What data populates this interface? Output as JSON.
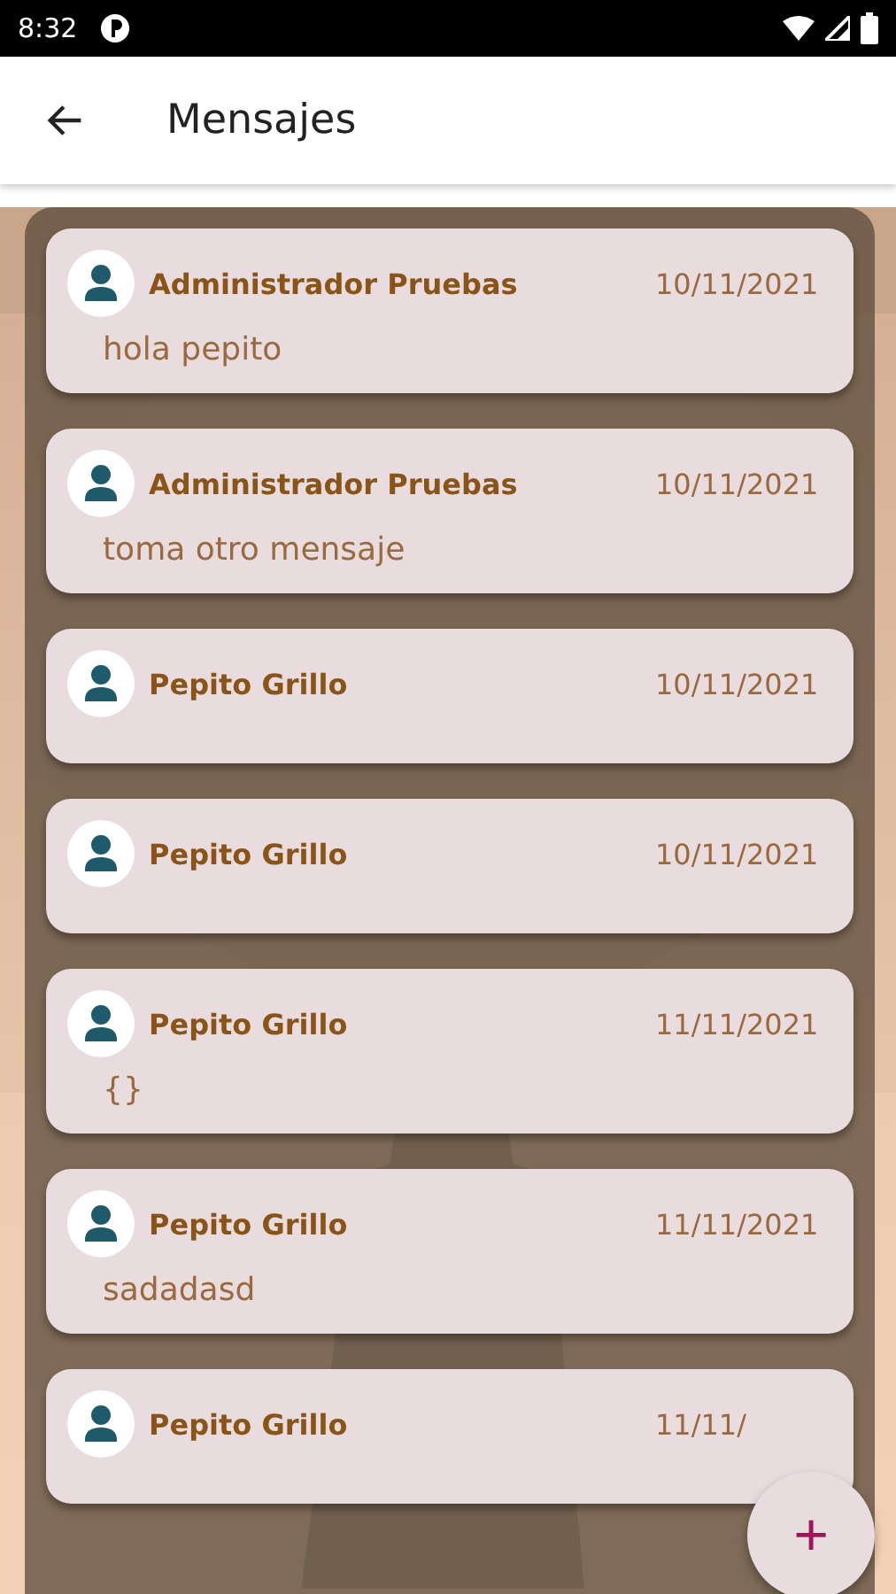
{
  "status_bar": {
    "time": "8:32"
  },
  "app_bar": {
    "title": "Mensajes"
  },
  "messages": [
    {
      "author": "Administrador Pruebas",
      "date": "10/11/2021",
      "text": "hola pepito"
    },
    {
      "author": "Administrador Pruebas",
      "date": "10/11/2021",
      "text": "toma otro mensaje"
    },
    {
      "author": "Pepito Grillo",
      "date": "10/11/2021"
    },
    {
      "author": "Pepito Grillo",
      "date": "10/11/2021"
    },
    {
      "author": "Pepito Grillo",
      "date": "11/11/2021",
      "text": "{}"
    },
    {
      "author": "Pepito Grillo",
      "date": "11/11/2021",
      "text": "sadadasd"
    },
    {
      "author": "Pepito Grillo",
      "date": "11/11/"
    }
  ],
  "fab": {
    "label": "+"
  }
}
